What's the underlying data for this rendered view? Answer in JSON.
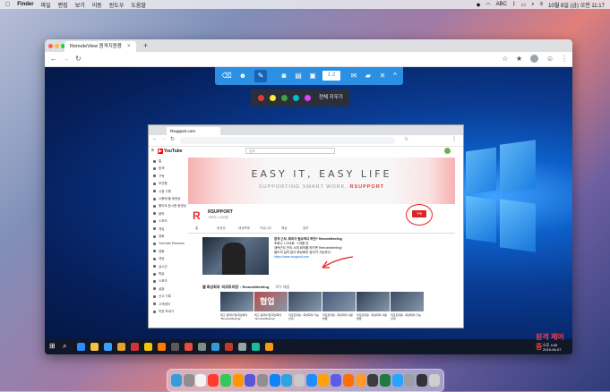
{
  "menubar": {
    "app_name": "Finder",
    "items": [
      "파일",
      "편집",
      "보기",
      "이동",
      "윈도우",
      "도움말"
    ],
    "input_source": "ABC",
    "datetime": "10월 8일 (금) 오전 11:17"
  },
  "browser": {
    "tab_title": "RemoteView 원격지원용",
    "tab_close": "×",
    "new_tab": "+"
  },
  "remote_toolbar": {
    "page_indicator": "1 2",
    "close_glyph": "✕",
    "collapse_glyph": "^",
    "pen_colors": [
      "#e53935",
      "#ffeb3b",
      "#43a047",
      "#00bcd4",
      "#e040fb"
    ],
    "clear_all_label": "전체 지우기"
  },
  "remote_browser": {
    "tab_title": "Rsupport.com",
    "youtube_logo": "YouTube",
    "search_placeholder": "검색",
    "banner_title": "EASY IT, EASY LIFE",
    "banner_sub_prefix": "SUPPORTING SMART WORK, ",
    "banner_sub_brand": "RSUPPORT",
    "channel_name": "RSUPPORT",
    "channel_subs": "구독자 1,490명",
    "subscribe_label": "구독",
    "channel_tabs": [
      "홈",
      "동영상",
      "재생목록",
      "커뮤니티",
      "채널",
      "정보"
    ],
    "video_lines": [
      "원격 근무, 회의가 필요하다 하면? RemoteMeeting",
      "조회수 1,234회 · 1개월 전",
      "재택근무 관리 시에 회의를 하려면 RemoteMeeting!",
      "별도의 설치 없이 화상회의 참여가 가능하다",
      "https://www.rsupport.com"
    ],
    "related_header": "웹 화상회의 '리모트미팅' : RemoteMeeting",
    "related_action": "모두 재생",
    "thumb_overlay": "협업",
    "thumb_captions": [
      "최고 실력의 웹 화상회의 \"RemoteMeeting\"",
      "최고 실력의 웹 화상회의 \"RemoteMeeting\"",
      "리모트미팅 - 화상회의 기능 안내",
      "리모트미팅 - 화상회의 사용 방법",
      "리모트미팅 - 화상회의 사용 방법",
      "리모트미팅 - 화상회의 기능 안내"
    ]
  },
  "sidebar_items": [
    "홈",
    "탐색",
    "구독",
    "보관함",
    "시청 기록",
    "나중에 볼 동영상",
    "좋아요 표시한 동영상",
    "음악",
    "스포츠",
    "게임",
    "영화",
    "YouTube Premium",
    "영화",
    "게임",
    "실시간",
    "학습",
    "스포츠",
    "설정",
    "신고 기록",
    "고객센터",
    "의견 보내기"
  ],
  "remote_status": {
    "label": "원격 제어 중",
    "time": "오후 4:45",
    "date": "2019-06-07"
  }
}
